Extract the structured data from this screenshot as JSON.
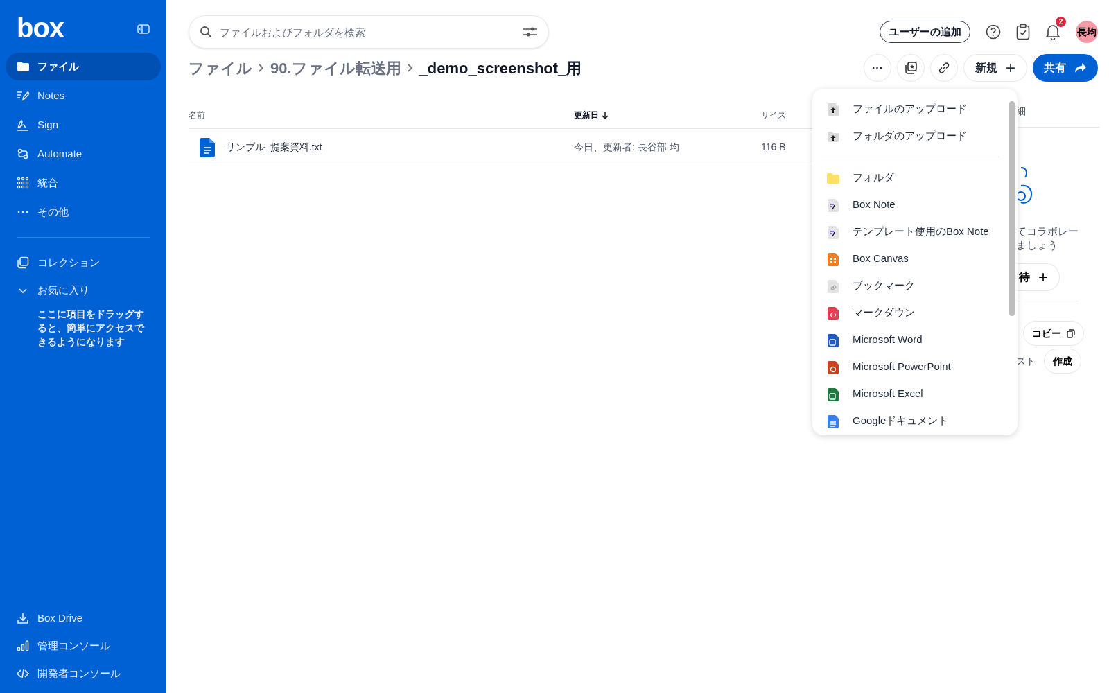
{
  "sidebar": {
    "logo": "box",
    "nav": [
      {
        "label": "ファイル",
        "selected": true
      },
      {
        "label": "Notes",
        "selected": false
      },
      {
        "label": "Sign",
        "selected": false
      },
      {
        "label": "Automate",
        "selected": false
      },
      {
        "label": "統合",
        "selected": false
      },
      {
        "label": "その他",
        "selected": false
      }
    ],
    "collections": {
      "label": "コレクション"
    },
    "favorites": {
      "label": "お気に入り",
      "expanded": true,
      "hint": "ここに項目をドラッグすると、簡単にアクセスできるようになります"
    },
    "bottom": [
      {
        "label": "Box Drive"
      },
      {
        "label": "管理コンソール"
      },
      {
        "label": "開発者コンソール"
      }
    ]
  },
  "search": {
    "placeholder": "ファイルおよびフォルダを検索"
  },
  "header": {
    "add_user": "ユーザーの追加",
    "notifications": "2",
    "avatar": "長均"
  },
  "breadcrumb": [
    "ファイル",
    "90.ファイル転送用",
    "_demo_screenshot_用"
  ],
  "actions": {
    "more": "···",
    "new": "新規",
    "new_plus": "+",
    "share": "共有"
  },
  "table": {
    "columns": [
      {
        "label": "名前",
        "sorted": false
      },
      {
        "label": "更新日",
        "sorted": true
      },
      {
        "label": "サイズ",
        "sorted": false
      }
    ],
    "rows": [
      {
        "name": "サンプル_提案資料.txt",
        "modified": "今日、更新者: 長谷部 均",
        "size": "116 B"
      }
    ]
  },
  "new_menu": {
    "sections": [
      [
        {
          "kind": "upload-file",
          "label": "ファイルのアップロード"
        },
        {
          "kind": "upload-folder",
          "label": "フォルダのアップロード"
        }
      ],
      [
        {
          "kind": "folder",
          "label": "フォルダ"
        },
        {
          "kind": "note",
          "label": "Box Note"
        },
        {
          "kind": "note",
          "label": "テンプレート使用のBox Note"
        },
        {
          "kind": "canvas",
          "label": "Box Canvas"
        },
        {
          "kind": "bookmark",
          "label": "ブックマーク"
        },
        {
          "kind": "markdown",
          "label": "マークダウン"
        },
        {
          "kind": "word",
          "label": "Microsoft Word"
        },
        {
          "kind": "powerpoint",
          "label": "Microsoft PowerPoint"
        },
        {
          "kind": "excel",
          "label": "Microsoft Excel"
        },
        {
          "kind": "gdoc",
          "label": "Googleドキュメント"
        }
      ]
    ]
  },
  "side_panel": {
    "tab": "細",
    "text_line_1": "てコラボレー",
    "text_line_2": "ましょう",
    "invite": "待",
    "invite_plus": "+",
    "copy": "コピー",
    "text_3": "スト",
    "create": "作成"
  }
}
